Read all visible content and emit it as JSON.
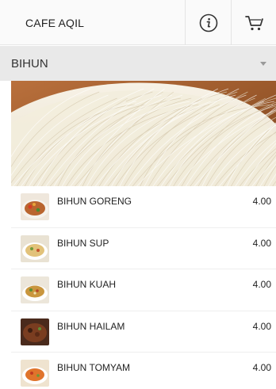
{
  "header": {
    "shop_name": "CAFE AQIL",
    "info_icon": "info-circle-icon",
    "cart_icon": "shopping-cart-icon"
  },
  "category_select": {
    "selected": "BIHUN",
    "caret_icon": "caret-down-icon"
  },
  "banner": {
    "image": "bihun-noodles-photo"
  },
  "menu": {
    "items": [
      {
        "name": "BIHUN GORENG",
        "price": "4.00",
        "thumb": "fried-bihun-photo"
      },
      {
        "name": "BIHUN SUP",
        "price": "4.00",
        "thumb": "bihun-soup-photo"
      },
      {
        "name": "BIHUN KUAH",
        "price": "4.00",
        "thumb": "bihun-kuah-photo"
      },
      {
        "name": "BIHUN HAILAM",
        "price": "4.00",
        "thumb": "bihun-hailam-photo"
      },
      {
        "name": "BIHUN TOMYAM",
        "price": "4.00",
        "thumb": "bihun-tomyam-photo"
      }
    ]
  },
  "colors": {
    "topbar_bg": "#fafafa",
    "category_bg": "#e9e9e9",
    "text": "#222222"
  }
}
